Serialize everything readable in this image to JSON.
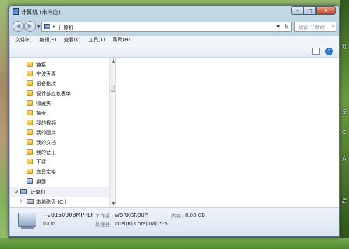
{
  "window": {
    "title": "计算机 (未响应)",
    "controls": {
      "minimize": "–",
      "maximize": "□",
      "close": "✕"
    }
  },
  "nav": {
    "back_glyph": "◀",
    "forward_glyph": "▶",
    "address_sep": "▸",
    "address_text": "计算机",
    "dropdown_glyph": "▼",
    "refresh_glyph": "↻",
    "search_placeholder": "搜索 计算机"
  },
  "menu": [
    "文件(F)",
    "编辑(E)",
    "查看(V)",
    "工具(T)",
    "帮助(H)"
  ],
  "toolbar": {
    "help_glyph": "?"
  },
  "sidebar": {
    "items": [
      {
        "label": "链接",
        "icon": "folder-link-icon"
      },
      {
        "label": "宁波天喜",
        "icon": "folder-icon"
      },
      {
        "label": "设备指纹",
        "icon": "folder-icon"
      },
      {
        "label": "设计部应收表单",
        "icon": "folder-icon"
      },
      {
        "label": "收藏夹",
        "icon": "folder-icon"
      },
      {
        "label": "搜索",
        "icon": "folder-icon"
      },
      {
        "label": "我的视频",
        "icon": "folder-icon"
      },
      {
        "label": "我的图片",
        "icon": "folder-icon"
      },
      {
        "label": "我的文档",
        "icon": "folder-icon"
      },
      {
        "label": "我的音乐",
        "icon": "folder-icon"
      },
      {
        "label": "下载",
        "icon": "folder-icon"
      },
      {
        "label": "宜昌宏裕",
        "icon": "folder-icon"
      },
      {
        "label": "桌面",
        "icon": "desktop-icon"
      }
    ],
    "computer_label": "计算机",
    "drive_label": "本地磁盘 (C:)"
  },
  "details": {
    "computer_name": "--20150908MPPLF",
    "user": "hallo",
    "workgroup_key": "工作组:",
    "workgroup_val": "WORKGROUP",
    "memory_key": "内存:",
    "memory_val": "8.00 GB",
    "cpu_key": "处理器:",
    "cpu_val": "Intel(R) Core(TM) i5-5..."
  },
  "desktop": {
    "side_labels": [
      "双",
      "岳",
      "C",
      "文",
      "后"
    ]
  }
}
